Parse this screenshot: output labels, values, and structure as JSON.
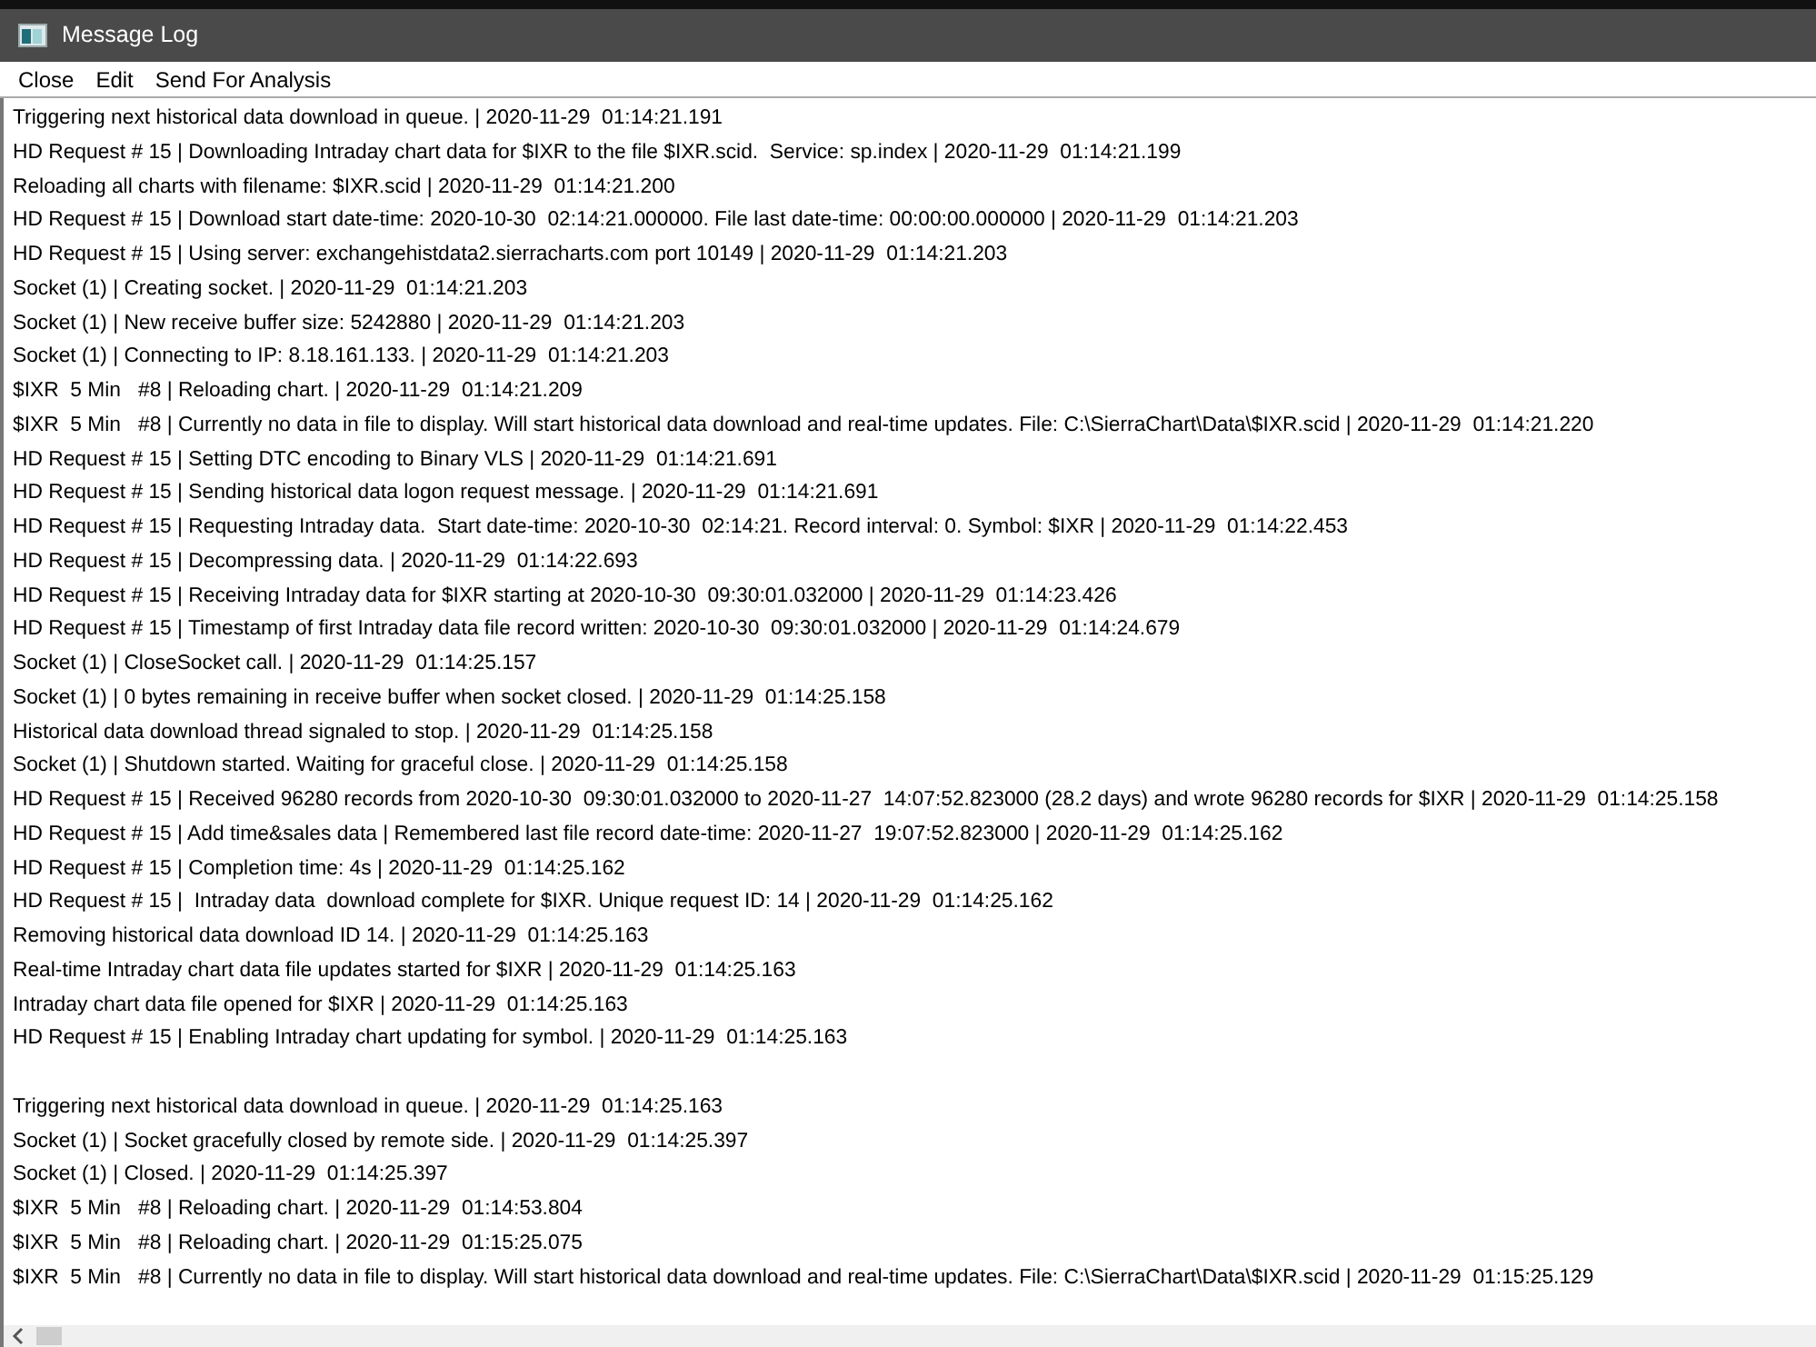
{
  "window": {
    "title": "Message Log"
  },
  "menu": [
    "Close",
    "Edit",
    "Send For Analysis"
  ],
  "log": [
    {
      "text": "Triggering next historical data download in queue. | 2020-11-29  01:14:21.191"
    },
    {
      "text": "HD Request # 15 | Downloading Intraday chart data for $IXR to the file $IXR.scid.  Service: sp.index | 2020-11-29  01:14:21.199"
    },
    {
      "text": "Reloading all charts with filename: $IXR.scid | 2020-11-29  01:14:21.200"
    },
    {
      "text": "HD Request # 15 | Download start date-time: 2020-10-30  02:14:21.000000. File last date-time: 00:00:00.000000 | 2020-11-29  01:14:21.203"
    },
    {
      "text": "HD Request # 15 | Using server: exchangehistdata2.sierracharts.com port 10149 | 2020-11-29  01:14:21.203"
    },
    {
      "text": "Socket (1) | Creating socket. | 2020-11-29  01:14:21.203"
    },
    {
      "text": "Socket (1) | New receive buffer size: 5242880 | 2020-11-29  01:14:21.203"
    },
    {
      "text": "Socket (1) | Connecting to IP: 8.18.161.133. | 2020-11-29  01:14:21.203"
    },
    {
      "text": "$IXR  5 Min   #8 | Reloading chart. | 2020-11-29  01:14:21.209"
    },
    {
      "text": "$IXR  5 Min   #8 | Currently no data in file to display. Will start historical data download and real-time updates. File: C:\\SierraChart\\Data\\$IXR.scid | 2020-11-29  01:14:21.220"
    },
    {
      "text": "HD Request # 15 | Setting DTC encoding to Binary VLS | 2020-11-29  01:14:21.691"
    },
    {
      "text": "HD Request # 15 | Sending historical data logon request message. | 2020-11-29  01:14:21.691"
    },
    {
      "text": "HD Request # 15 | Requesting Intraday data.  Start date-time: 2020-10-30  02:14:21. Record interval: 0. Symbol: $IXR | 2020-11-29  01:14:22.453"
    },
    {
      "text": "HD Request # 15 | Decompressing data. | 2020-11-29  01:14:22.693"
    },
    {
      "text": "HD Request # 15 | Receiving Intraday data for $IXR starting at 2020-10-30  09:30:01.032000 | 2020-11-29  01:14:23.426"
    },
    {
      "text": "HD Request # 15 | Timestamp of first Intraday data file record written: 2020-10-30  09:30:01.032000 | 2020-11-29  01:14:24.679"
    },
    {
      "text": "Socket (1) | CloseSocket call. | 2020-11-29  01:14:25.157"
    },
    {
      "text": "Socket (1) | 0 bytes remaining in receive buffer when socket closed. | 2020-11-29  01:14:25.158"
    },
    {
      "text": "Historical data download thread signaled to stop. | 2020-11-29  01:14:25.158"
    },
    {
      "text": "Socket (1) | Shutdown started. Waiting for graceful close. | 2020-11-29  01:14:25.158"
    },
    {
      "text": "HD Request # 15 | Received 96280 records from 2020-10-30  09:30:01.032000 to 2020-11-27  14:07:52.823000 (28.2 days) and wrote 96280 records for $IXR | 2020-11-29  01:14:25.158"
    },
    {
      "text": "HD Request # 15 | Add time&sales data | Remembered last file record date-time: 2020-11-27  19:07:52.823000 | 2020-11-29  01:14:25.162"
    },
    {
      "text": "HD Request # 15 | Completion time: 4s | 2020-11-29  01:14:25.162"
    },
    {
      "text": "HD Request # 15 |  Intraday data  download complete for $IXR. Unique request ID: 14 | 2020-11-29  01:14:25.162"
    },
    {
      "text": "Removing historical data download ID 14. | 2020-11-29  01:14:25.163"
    },
    {
      "text": "Real-time Intraday chart data file updates started for $IXR | 2020-11-29  01:14:25.163"
    },
    {
      "text": "Intraday chart data file opened for $IXR | 2020-11-29  01:14:25.163"
    },
    {
      "text": "HD Request # 15 | Enabling Intraday chart updating for symbol. | 2020-11-29  01:14:25.163"
    },
    {
      "text": "Triggering next historical data download in queue. | 2020-11-29  01:14:25.163",
      "blank_line_before": true
    },
    {
      "text": "Socket (1) | Socket gracefully closed by remote side. | 2020-11-29  01:14:25.397"
    },
    {
      "text": "Socket (1) | Closed. | 2020-11-29  01:14:25.397"
    },
    {
      "text": "$IXR  5 Min   #8 | Reloading chart. | 2020-11-29  01:14:53.804"
    },
    {
      "text": "$IXR  5 Min   #8 | Reloading chart. | 2020-11-29  01:15:25.075"
    },
    {
      "text": "$IXR  5 Min   #8 | Currently no data in file to display. Will start historical data download and real-time updates. File: C:\\SierraChart\\Data\\$IXR.scid | 2020-11-29  01:15:25.129"
    }
  ]
}
